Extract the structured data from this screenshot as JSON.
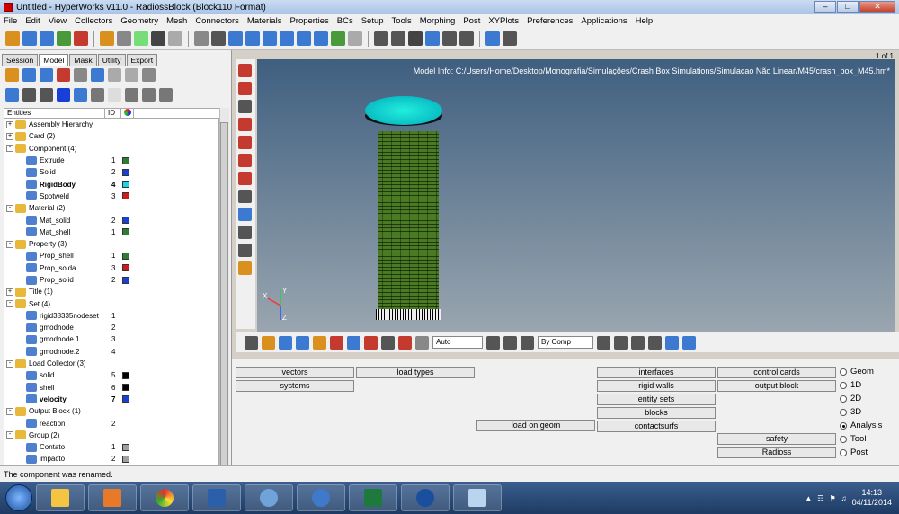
{
  "window": {
    "title": "Untitled - HyperWorks v11.0 - RadiossBlock (Block110 Format)",
    "controls": [
      "minimize",
      "maximize",
      "close"
    ]
  },
  "menu": [
    "File",
    "Edit",
    "View",
    "Collectors",
    "Geometry",
    "Mesh",
    "Connectors",
    "Materials",
    "Properties",
    "BCs",
    "Setup",
    "Tools",
    "Morphing",
    "Post",
    "XYPlots",
    "Preferences",
    "Applications",
    "Help"
  ],
  "tabs": [
    "Session",
    "Model",
    "Mask",
    "Utility",
    "Export"
  ],
  "entities_header": {
    "name": "Entities",
    "id": "ID"
  },
  "tree": [
    {
      "label": "Assembly Hierarchy",
      "level": 0,
      "exp": "+"
    },
    {
      "label": "Card (2)",
      "level": 0,
      "exp": "+"
    },
    {
      "label": "Component (4)",
      "level": 0,
      "exp": "-"
    },
    {
      "label": "Extrude",
      "level": 1,
      "id": "1",
      "color": "#2e7d32"
    },
    {
      "label": "Solid",
      "level": 1,
      "id": "2",
      "color": "#1a3fd6"
    },
    {
      "label": "RigidBody",
      "level": 1,
      "id": "4",
      "color": "#18d6e8",
      "bold": true
    },
    {
      "label": "Spotweld",
      "level": 1,
      "id": "3",
      "color": "#d31818"
    },
    {
      "label": "Material (2)",
      "level": 0,
      "exp": "-"
    },
    {
      "label": "Mat_solid",
      "level": 1,
      "id": "2",
      "color": "#1a3fd6"
    },
    {
      "label": "Mat_shell",
      "level": 1,
      "id": "1",
      "color": "#2e7d32"
    },
    {
      "label": "Property (3)",
      "level": 0,
      "exp": "-"
    },
    {
      "label": "Prop_shell",
      "level": 1,
      "id": "1",
      "color": "#2e7d32"
    },
    {
      "label": "Prop_solda",
      "level": 1,
      "id": "3",
      "color": "#d31818"
    },
    {
      "label": "Prop_solid",
      "level": 1,
      "id": "2",
      "color": "#1a3fd6"
    },
    {
      "label": "Title (1)",
      "level": 0,
      "exp": "+"
    },
    {
      "label": "Set (4)",
      "level": 0,
      "exp": "-"
    },
    {
      "label": "rigid38335nodeset",
      "level": 1,
      "id": "1"
    },
    {
      "label": "gmodnode",
      "level": 1,
      "id": "2"
    },
    {
      "label": "gmodnode.1",
      "level": 1,
      "id": "3"
    },
    {
      "label": "gmodnode.2",
      "level": 1,
      "id": "4"
    },
    {
      "label": "Load Collector (3)",
      "level": 0,
      "exp": "-"
    },
    {
      "label": "solid",
      "level": 1,
      "id": "5",
      "color": "#000000"
    },
    {
      "label": "shell",
      "level": 1,
      "id": "6",
      "color": "#000000"
    },
    {
      "label": "velocity",
      "level": 1,
      "id": "7",
      "color": "#1a3fd6",
      "bold": true
    },
    {
      "label": "Output Block (1)",
      "level": 0,
      "exp": "-"
    },
    {
      "label": "reaction",
      "level": 1,
      "id": "2"
    },
    {
      "label": "Group (2)",
      "level": 0,
      "exp": "-"
    },
    {
      "label": "Contato",
      "level": 1,
      "id": "1",
      "color": "#a0a0a0"
    },
    {
      "label": "impacto",
      "level": 1,
      "id": "2",
      "color": "#a0a0a0"
    }
  ],
  "viewport": {
    "model_info": "Model Info: C:/Users/Home/Desktop/Monografia/Simulações/Crash Box Simulations/Simulacao Não Linear/M45/crash_box_M45.hm*",
    "page": "1 of 1",
    "axis_y": "Y",
    "axis_x": "X",
    "axis_z": "Z"
  },
  "view_toolbar": {
    "auto_label": "Auto",
    "by_comp_label": "By Comp"
  },
  "panel": {
    "col1": [
      "vectors",
      "systems"
    ],
    "col2": [
      "load types"
    ],
    "col3": [
      "load on geom"
    ],
    "col4": [
      "interfaces",
      "rigid walls",
      "entity sets",
      "blocks",
      "contactsurfs"
    ],
    "col5": [
      "control cards",
      "output block",
      "safety",
      "Radioss"
    ],
    "radios": [
      "Geom",
      "1D",
      "2D",
      "3D",
      "Analysis",
      "Tool",
      "Post"
    ],
    "selected_radio": "Analysis"
  },
  "status": "The component was renamed.",
  "taskbar": {
    "time": "14:13",
    "date": "04/11/2014"
  }
}
